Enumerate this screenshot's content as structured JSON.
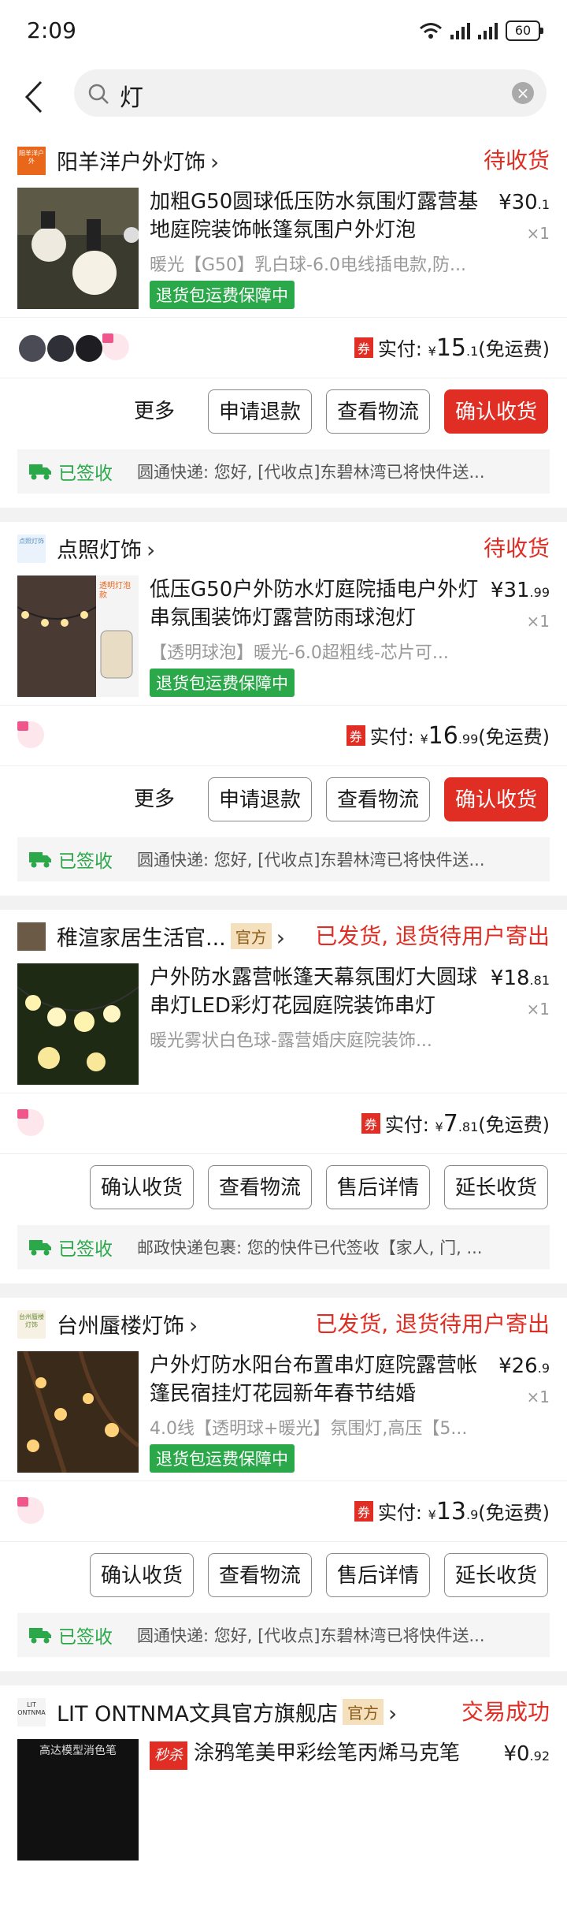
{
  "status_bar": {
    "time": "2:09",
    "battery": "60"
  },
  "search": {
    "query": "灯"
  },
  "orders": [
    {
      "shop": "阳羊洋户外灯饰",
      "shop_logo_text": "阳羊洋户外",
      "status": "待收货",
      "title": "加粗G50圆球低压防水氛围灯露营基地庭院装饰帐篷氛围户外灯泡",
      "price_int": "¥30",
      "price_dec": ".1",
      "qty": "×1",
      "sku": "暖光【G50】乳白球-6.0电线插电款,防...",
      "tag": "退货包运费保障中",
      "paid_label": "实付:",
      "paid_currency": "¥",
      "paid_int": "15",
      "paid_dec": ".1",
      "shipping": "(免运费)",
      "buttons": [
        "更多",
        "申请退款",
        "查看物流",
        "确认收货"
      ],
      "signed": "已签收",
      "logistics": "圆通快递: 您好, [代收点]东碧林湾已将快件送..."
    },
    {
      "shop": "点照灯饰",
      "shop_logo_text": "点照灯饰",
      "status": "待收货",
      "title": "低压G50户外防水灯庭院插电户外灯串氛围装饰灯露营防雨球泡灯",
      "thumb_text": "透明灯泡款",
      "price_int": "¥31",
      "price_dec": ".99",
      "qty": "×1",
      "sku": "【透明球泡】暖光-6.0超粗线-芯片可...",
      "tag": "退货包运费保障中",
      "paid_label": "实付:",
      "paid_currency": "¥",
      "paid_int": "16",
      "paid_dec": ".99",
      "shipping": "(免运费)",
      "buttons": [
        "更多",
        "申请退款",
        "查看物流",
        "确认收货"
      ],
      "signed": "已签收",
      "logistics": "圆通快递: 您好, [代收点]东碧林湾已将快件送..."
    },
    {
      "shop": "稚渲家居生活官...",
      "official": "官方",
      "status": "已发货, 退货待用户寄出",
      "title": "户外防水露营帐篷天幕氛围灯大圆球串灯LED彩灯花园庭院装饰串灯",
      "price_int": "¥18",
      "price_dec": ".81",
      "qty": "×1",
      "sku": "暖光雾状白色球-露营婚庆庭院装饰...",
      "paid_label": "实付:",
      "paid_currency": "¥",
      "paid_int": "7",
      "paid_dec": ".81",
      "shipping": "(免运费)",
      "buttons": [
        "确认收货",
        "查看物流",
        "售后详情",
        "延长收货"
      ],
      "signed": "已签收",
      "logistics": "邮政快递包裹: 您的快件已代签收【家人, 门, ..."
    },
    {
      "shop": "台州蜃楼灯饰",
      "shop_logo_text": "台州蜃楼灯饰",
      "status": "已发货, 退货待用户寄出",
      "title": "户外灯防水阳台布置串灯庭院露营帐篷民宿挂灯花园新年春节结婚",
      "price_int": "¥26",
      "price_dec": ".9",
      "qty": "×1",
      "sku": "4.0线【透明球+暖光】氛围灯,高压【5...",
      "tag": "退货包运费保障中",
      "paid_label": "实付:",
      "paid_currency": "¥",
      "paid_int": "13",
      "paid_dec": ".9",
      "shipping": "(免运费)",
      "buttons": [
        "确认收货",
        "查看物流",
        "售后详情",
        "延长收货"
      ],
      "signed": "已签收",
      "logistics": "圆通快递: 您好, [代收点]东碧林湾已将快件送..."
    },
    {
      "shop": "LIT ONTNMA文具官方旗舰店",
      "shop_logo_text": "LIT ONTNMA",
      "official": "官方",
      "status": "交易成功",
      "flash": "秒杀",
      "title": "涂鸦笔美甲彩绘笔丙烯马克笔",
      "thumb_text": "高达模型消色笔",
      "price_int": "¥0",
      "price_dec": ".92"
    }
  ]
}
